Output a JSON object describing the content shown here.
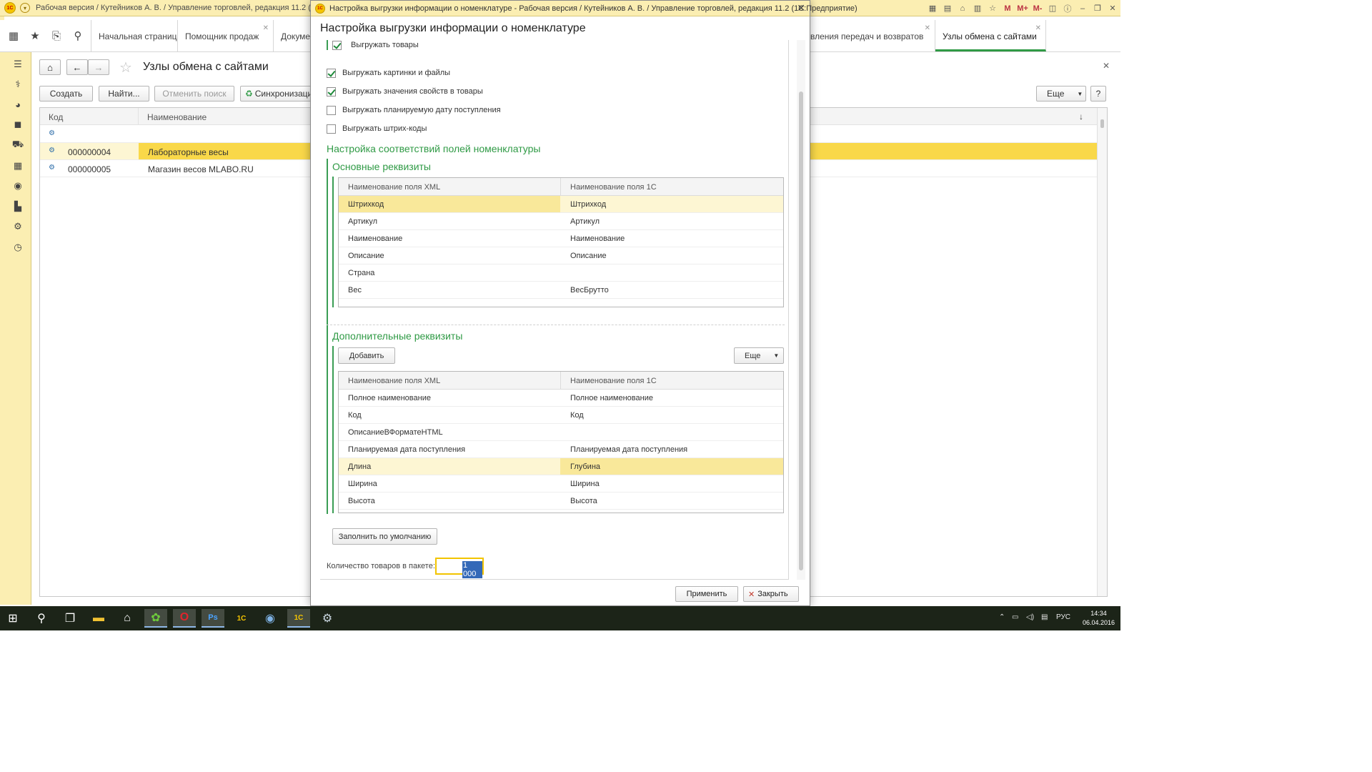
{
  "app": {
    "title": "Рабочая версия / Кутейников А. В. / Управление торговлей, редакция 11.2  (1С:Предприятие)"
  },
  "tabs": [
    {
      "label": "Начальная страница"
    },
    {
      "label": "Помощник продаж"
    },
    {
      "label": "Докумен"
    },
    {
      "label": "вления передач и возвратов"
    },
    {
      "label": "Узлы обмена с сайтами"
    }
  ],
  "background_form": {
    "title": "Узлы обмена с сайтами",
    "buttons": {
      "create": "Создать",
      "find": "Найти...",
      "cancel_search": "Отменить поиск",
      "sync": "Синхронизация",
      "more": "Еще",
      "help": "?"
    },
    "columns": [
      "Код",
      "Наименование"
    ],
    "rows": [
      {
        "code": "",
        "name": ""
      },
      {
        "code": "000000004",
        "name": "Лабораторные весы"
      },
      {
        "code": "000000005",
        "name": "Магазин весов MLABO.RU"
      }
    ]
  },
  "dialog": {
    "window_title": "Настройка выгрузки информации о номенклатуре - Рабочая версия / Кутейников А. В. / Управление торговлей, редакция 11.2  (1С:Предприятие)",
    "header": "Настройка выгрузки информации о номенклатуре",
    "checkboxes": [
      {
        "label": "Выгружать товары",
        "checked": true
      },
      {
        "label": "Выгружать картинки и файлы",
        "checked": true
      },
      {
        "label": "Выгружать значения свойств в товары",
        "checked": true
      },
      {
        "label": "Выгружать планируемую дату поступления",
        "checked": false
      },
      {
        "label": "Выгружать штрих-коды",
        "checked": false
      }
    ],
    "mapping_section_title": "Настройка соответствий полей номенклатуры",
    "main_attrs": {
      "title": "Основные реквизиты",
      "col_xml": "Наименование поля XML",
      "col_1c": "Наименование поля 1С",
      "rows": [
        {
          "xml": "Штрихкод",
          "c1": "Штрихкод"
        },
        {
          "xml": "Артикул",
          "c1": "Артикул"
        },
        {
          "xml": "Наименование",
          "c1": "Наименование"
        },
        {
          "xml": "Описание",
          "c1": "Описание"
        },
        {
          "xml": "Страна",
          "c1": ""
        },
        {
          "xml": "Вес",
          "c1": "ВесБрутто"
        }
      ]
    },
    "additional_attrs": {
      "title": "Дополнительные реквизиты",
      "add_button": "Добавить",
      "more_button": "Еще",
      "col_xml": "Наименование поля XML",
      "col_1c": "Наименование поля 1С",
      "rows": [
        {
          "xml": "Полное наименование",
          "c1": "Полное наименование"
        },
        {
          "xml": "Код",
          "c1": "Код"
        },
        {
          "xml": "ОписаниеВФорматеHTML",
          "c1": ""
        },
        {
          "xml": "Планируемая дата поступления",
          "c1": "Планируемая дата поступления"
        },
        {
          "xml": "Длина",
          "c1": "Глубина"
        },
        {
          "xml": "Ширина",
          "c1": "Ширина"
        },
        {
          "xml": "Высота",
          "c1": "Высота"
        }
      ]
    },
    "fill_default_button": "Заполнить по умолчанию",
    "qty_label": "Количество товаров в пакете:",
    "qty_value": "1 000",
    "apply_button": "Применить",
    "close_button": "Закрыть"
  },
  "taskbar": {
    "language": "РУС",
    "time": "14:34",
    "date": "06.04.2016"
  },
  "colors": {
    "accent_green": "#2f9a45",
    "panel_yellow": "#fbeeb2",
    "selection_yellow": "#f9d849"
  }
}
